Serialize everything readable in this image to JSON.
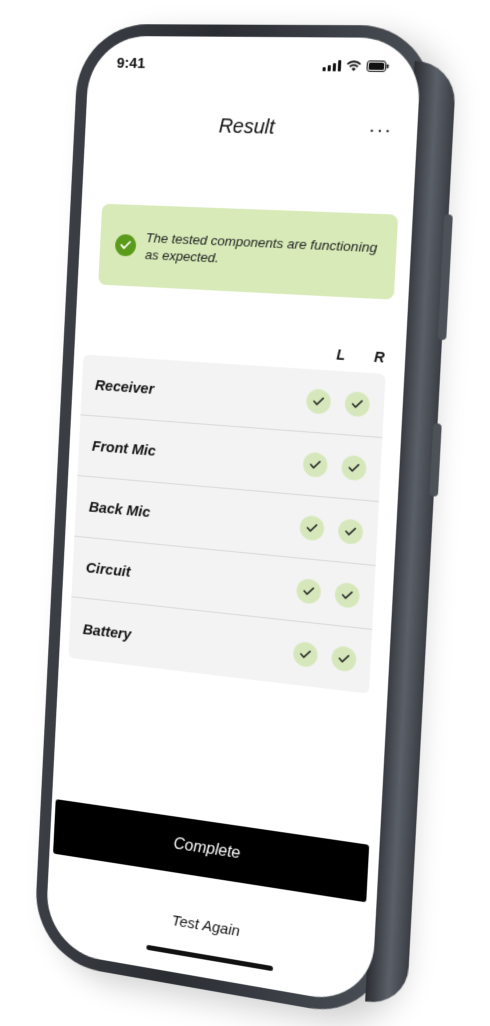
{
  "status_bar": {
    "time": "9:41"
  },
  "header": {
    "title": "Result",
    "more_label": "···"
  },
  "banner": {
    "message": "The tested components are functioning as expected."
  },
  "columns": {
    "left": "L",
    "right": "R"
  },
  "components": [
    {
      "name": "Receiver",
      "left": "pass",
      "right": "pass"
    },
    {
      "name": "Front Mic",
      "left": "pass",
      "right": "pass"
    },
    {
      "name": "Back Mic",
      "left": "pass",
      "right": "pass"
    },
    {
      "name": "Circuit",
      "left": "pass",
      "right": "pass"
    },
    {
      "name": "Battery",
      "left": "pass",
      "right": "pass"
    }
  ],
  "actions": {
    "complete_label": "Complete",
    "test_again_label": "Test Again"
  },
  "colors": {
    "banner_bg": "#d7eab8",
    "success": "#5a9b1c",
    "check_bg": "#d6e8bb",
    "primary_button": "#000000"
  },
  "icons": {
    "banner": "check-circle-icon",
    "row_status": "check-icon",
    "signal": "cellular-signal-icon",
    "wifi": "wifi-icon",
    "battery": "battery-icon"
  }
}
